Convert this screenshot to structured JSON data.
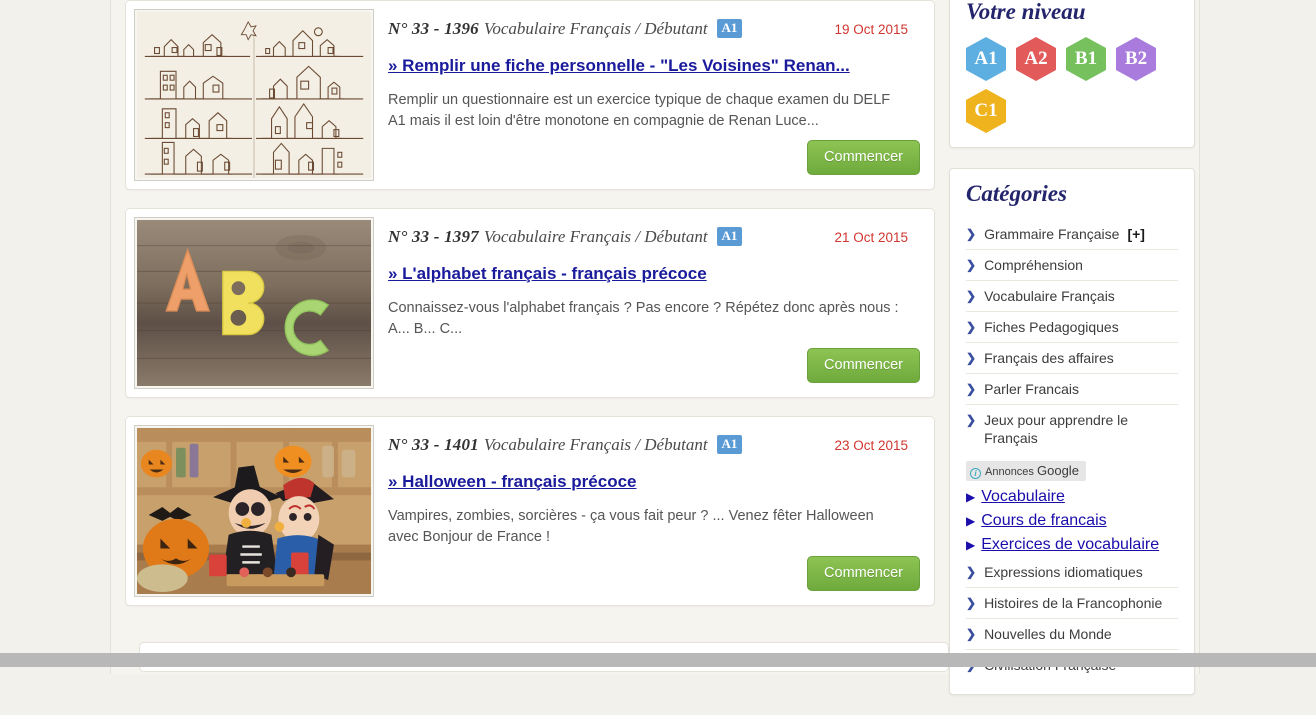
{
  "lessons": [
    {
      "number": "N° 33 - 1396",
      "category": "Vocabulaire Français / Débutant",
      "level": "A1",
      "date": "19 Oct 2015",
      "title": "» Remplir une fiche personnelle - \"Les Voisines\" Renan...",
      "description": "Remplir un questionnaire est un exercice typique de chaque examen du DELF A1 mais il est loin d'être monotone en compagnie de Renan Luce...",
      "button": "Commencer",
      "thumbnail": "sketch-of-houses-illustration"
    },
    {
      "number": "N° 33 - 1397",
      "category": "Vocabulaire Français / Débutant",
      "level": "A1",
      "date": "21 Oct 2015",
      "title": "» L'alphabet français - français précoce",
      "description": "Connaissez-vous l'alphabet français ? Pas encore ? Répétez donc après nous : A... B... C...",
      "button": "Commencer",
      "thumbnail": "abc-letters-on-wood-photo"
    },
    {
      "number": "N° 33 - 1401",
      "category": "Vocabulaire Français / Débutant",
      "level": "A1",
      "date": "23 Oct 2015",
      "title": "» Halloween - français précoce",
      "description": "Vampires, zombies, sorcières - ça vous fait peur ? ... Venez fêter Halloween avec Bonjour de France !",
      "button": "Commencer",
      "thumbnail": "halloween-children-costumes-photo"
    }
  ],
  "sidebar": {
    "levels_widget": {
      "title": "Votre niveau",
      "badges": [
        {
          "label": "A1",
          "color": "#5cafe0"
        },
        {
          "label": "A2",
          "color": "#e25a5a"
        },
        {
          "label": "B1",
          "color": "#76c15e"
        },
        {
          "label": "B2",
          "color": "#a97bdd"
        },
        {
          "label": "C1",
          "color": "#efb31e"
        }
      ]
    },
    "categories_widget": {
      "title": "Catégories",
      "items": [
        {
          "label": "Grammaire Française",
          "expand": "[+]"
        },
        {
          "label": "Compréhension"
        },
        {
          "label": "Vocabulaire Français"
        },
        {
          "label": "Fiches Pedagogiques"
        },
        {
          "label": "Français des affaires"
        },
        {
          "label": "Parler Francais"
        },
        {
          "label": "Jeux pour apprendre le Français"
        }
      ],
      "ads": {
        "label_text": "Annonces",
        "label_brand": "Google",
        "links": [
          "Vocabulaire",
          "Cours de francais",
          "Exercices de vocabulaire"
        ]
      },
      "items_after_ads": [
        {
          "label": "Expressions idiomatiques"
        },
        {
          "label": "Histoires de la Francophonie"
        },
        {
          "label": "Nouvelles du Monde"
        },
        {
          "label": "Civilisation Française"
        }
      ]
    }
  },
  "colors": {
    "page_background": "#f2f1ec",
    "card_background": "#ffffff",
    "accent_blue": "#5b9bd5",
    "link_blue": "#1a1a9c",
    "date_red": "#d0362f",
    "button_green": "#7ab648",
    "heading_navy": "#23246b"
  }
}
